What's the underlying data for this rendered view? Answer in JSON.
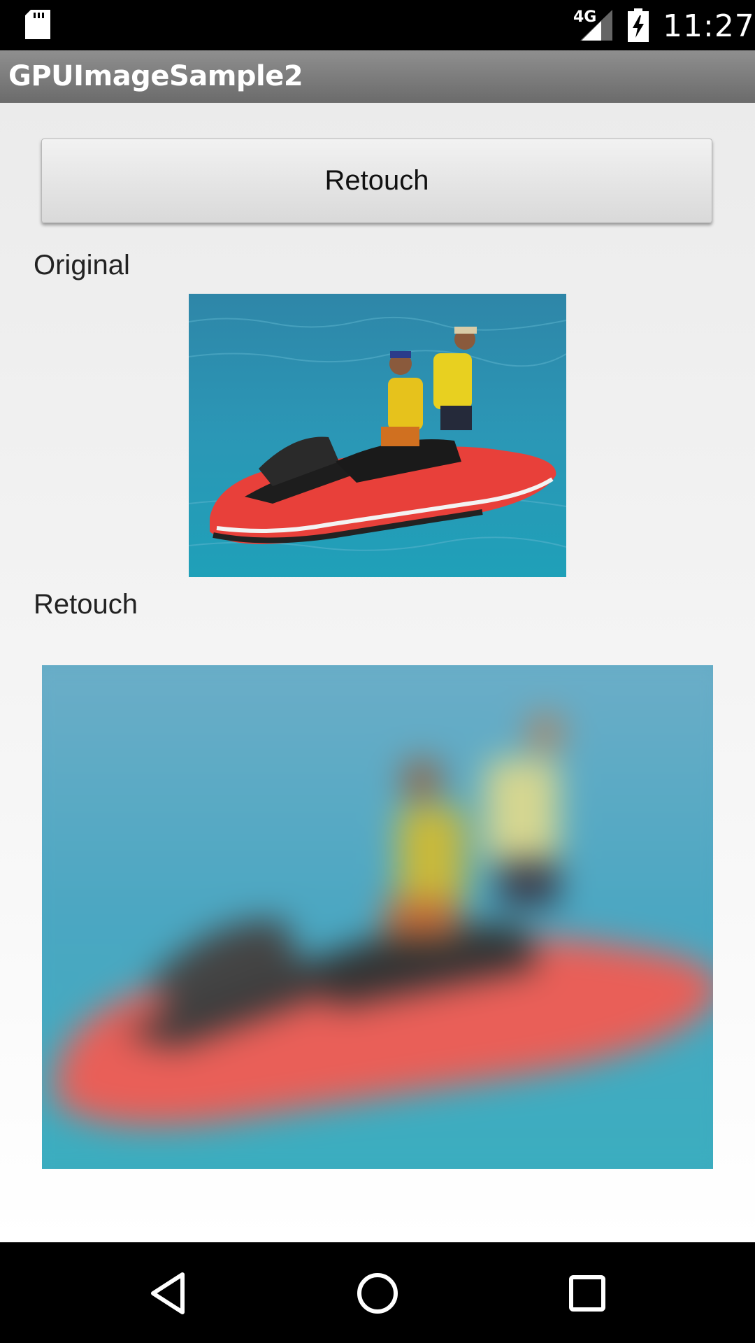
{
  "status_bar": {
    "network_type": "4G",
    "time": "11:27"
  },
  "app_bar": {
    "title": "GPUImageSample2"
  },
  "main": {
    "retouch_button_label": "Retouch",
    "original_label": "Original",
    "retouch_label": "Retouch"
  },
  "icons": {
    "sd_card": "sd-card-icon",
    "signal": "signal-icon",
    "battery": "battery-charging-icon",
    "back": "back-icon",
    "home": "home-icon",
    "recents": "recents-icon"
  },
  "colors": {
    "status_bar": "#000000",
    "app_bar": "#7c7c7c",
    "background": "#f0f0f0",
    "water": "#2b8fb0",
    "jetski": "#e8403a"
  }
}
